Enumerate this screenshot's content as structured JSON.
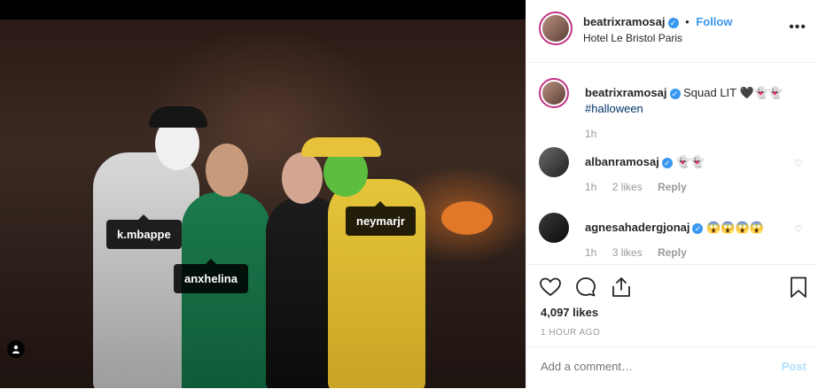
{
  "tags": [
    "k.mbappe",
    "anxhelina",
    "neymarjr"
  ],
  "header": {
    "username": "beatrixramosaj",
    "separator": "•",
    "follow_label": "Follow",
    "location": "Hotel Le Bristol Paris",
    "more": "•••"
  },
  "caption": {
    "username": "beatrixramosaj",
    "text": "Squad LIT 🖤👻👻",
    "hashtag": "#halloween",
    "time": "1h"
  },
  "comments": [
    {
      "username": "albanramosaj",
      "text": "👻👻",
      "time": "1h",
      "likes": "2 likes",
      "reply": "Reply"
    },
    {
      "username": "agnesahadergjonaj",
      "text": "😱😱😱😱",
      "time": "1h",
      "likes": "3 likes",
      "reply": "Reply"
    }
  ],
  "actions": {
    "likes": "4,097 likes",
    "timestamp": "1 HOUR AGO",
    "add_comment_placeholder": "Add a comment…",
    "post_label": "Post"
  },
  "icons": [
    "heart-icon",
    "comment-icon",
    "share-icon",
    "bookmark-icon",
    "user-tag-icon",
    "verified-icon",
    "more-icon"
  ],
  "colors": {
    "accent": "#3897f0",
    "post_disabled": "#b2dffc",
    "story_ring": "#c13584"
  }
}
